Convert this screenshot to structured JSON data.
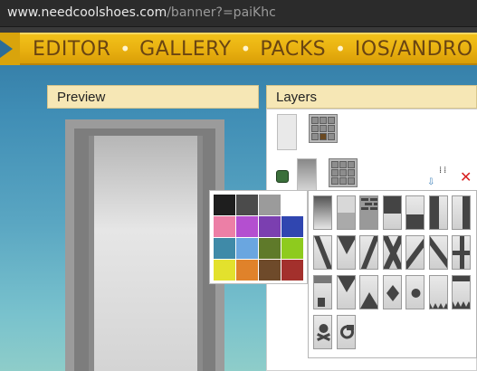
{
  "browser": {
    "url_host": "www.needcoolshoes.com",
    "url_path": "/banner?=paiKhc"
  },
  "nav": {
    "items": [
      "EDITOR",
      "GALLERY",
      "PACKS",
      "IOS/ANDRO"
    ],
    "separator": "•"
  },
  "panels": {
    "preview_title": "Preview",
    "layers_title": "Layers"
  },
  "layers": {
    "delete_icon": "✕",
    "drag_handle": "⁞⁞",
    "move_down_icon": "⇩"
  },
  "palette": {
    "colors": [
      "#1e1e1e",
      "#4b4b4b",
      "#9b9b9b",
      "#ffffff",
      "#ec7fa6",
      "#b44fd0",
      "#7b3fb0",
      "#3046b0",
      "#3f8aa8",
      "#6aa6e0",
      "#5f7a2a",
      "#8ecb1e",
      "#e3e12d",
      "#e0822a",
      "#6e4a2a",
      "#a3302c"
    ]
  },
  "colors": {
    "nav_text": "#6a4512",
    "nav_bg": "#e8b010",
    "panel_header_bg": "#f6e7b5",
    "delete": "#d82020"
  }
}
